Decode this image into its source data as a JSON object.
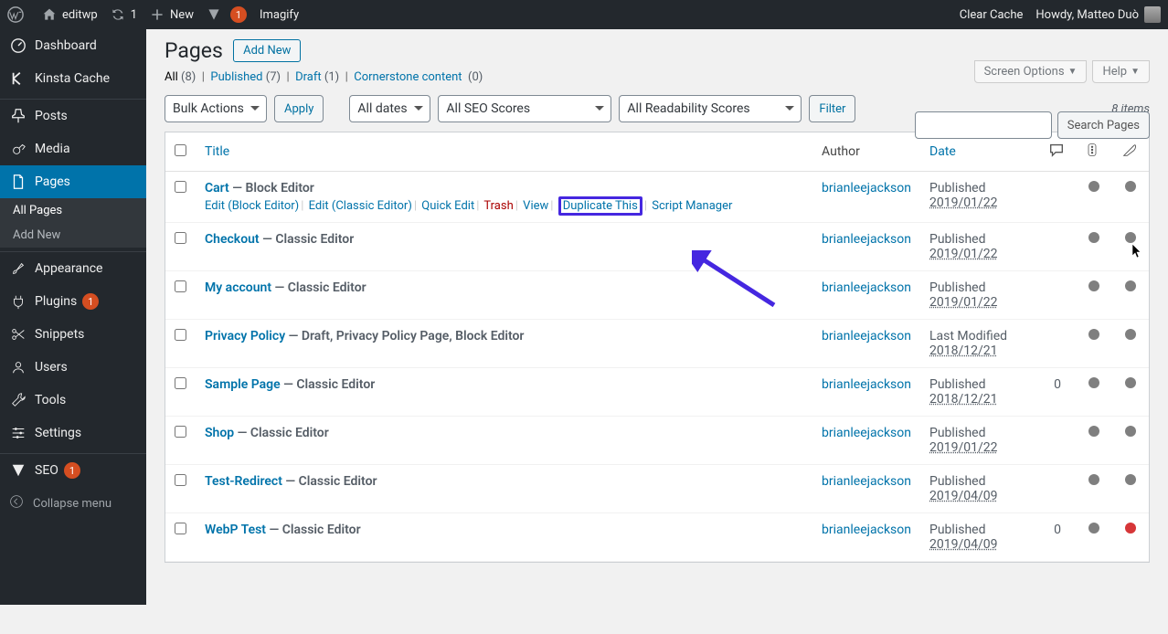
{
  "adminbar": {
    "site": "editwp",
    "refresh_count": "1",
    "new": "New",
    "vplugin_count": "1",
    "imagify": "Imagify",
    "clear_cache": "Clear Cache",
    "howdy": "Howdy, Matteo Duò"
  },
  "sidebar": {
    "dashboard": "Dashboard",
    "kinsta": "Kinsta Cache",
    "posts": "Posts",
    "media": "Media",
    "pages": "Pages",
    "all_pages": "All Pages",
    "add_new": "Add New",
    "appearance": "Appearance",
    "plugins": "Plugins",
    "plugins_badge": "1",
    "snippets": "Snippets",
    "users": "Users",
    "tools": "Tools",
    "settings": "Settings",
    "seo": "SEO",
    "seo_badge": "1",
    "collapse": "Collapse menu"
  },
  "header": {
    "title": "Pages",
    "add_new": "Add New",
    "screen_options": "Screen Options",
    "help": "Help"
  },
  "filters": {
    "views": {
      "all": "All",
      "all_count": "(8)",
      "published": "Published",
      "published_count": "(7)",
      "draft": "Draft",
      "draft_count": "(1)",
      "cornerstone": "Cornerstone content",
      "cornerstone_count": "(0)"
    },
    "bulk": "Bulk Actions",
    "apply": "Apply",
    "all_dates": "All dates",
    "seo": "All SEO Scores",
    "read": "All Readability Scores",
    "filter": "Filter",
    "search": "Search Pages",
    "items": "8 items"
  },
  "columns": {
    "title": "Title",
    "author": "Author",
    "date": "Date",
    "comments": ""
  },
  "row_actions": {
    "edit_be": "Edit (Block Editor)",
    "edit_ce": "Edit (Classic Editor)",
    "quick": "Quick Edit",
    "trash": "Trash",
    "view": "View",
    "dup": "Duplicate This",
    "script": "Script Manager"
  },
  "rows": [
    {
      "title": "Cart",
      "state": "— Block Editor",
      "author": "brianleejackson",
      "date_label": "Published",
      "date": "2019/01/22",
      "comments": "",
      "seo": "gray",
      "read": "gray",
      "show_actions": true
    },
    {
      "title": "Checkout",
      "state": "— Classic Editor",
      "author": "brianleejackson",
      "date_label": "Published",
      "date": "2019/01/22",
      "comments": "",
      "seo": "gray",
      "read": "gray"
    },
    {
      "title": "My account",
      "state": "— Classic Editor",
      "author": "brianleejackson",
      "date_label": "Published",
      "date": "2019/01/22",
      "comments": "",
      "seo": "gray",
      "read": "gray"
    },
    {
      "title": "Privacy Policy",
      "state": "— Draft, Privacy Policy Page, Block Editor",
      "author": "brianleejackson",
      "date_label": "Last Modified",
      "date": "2018/12/21",
      "comments": "",
      "seo": "gray",
      "read": "gray"
    },
    {
      "title": "Sample Page",
      "state": "— Classic Editor",
      "author": "brianleejackson",
      "date_label": "Published",
      "date": "2018/12/21",
      "comments": "0",
      "seo": "gray",
      "read": "gray"
    },
    {
      "title": "Shop",
      "state": "— Classic Editor",
      "author": "brianleejackson",
      "date_label": "Published",
      "date": "2019/01/22",
      "comments": "",
      "seo": "gray",
      "read": "gray"
    },
    {
      "title": "Test-Redirect",
      "state": "— Classic Editor",
      "author": "brianleejackson",
      "date_label": "Published",
      "date": "2019/04/09",
      "comments": "",
      "seo": "gray",
      "read": "gray"
    },
    {
      "title": "WebP Test",
      "state": "— Classic Editor",
      "author": "brianleejackson",
      "date_label": "Published",
      "date": "2019/04/09",
      "comments": "0",
      "seo": "gray",
      "read": "red"
    }
  ]
}
